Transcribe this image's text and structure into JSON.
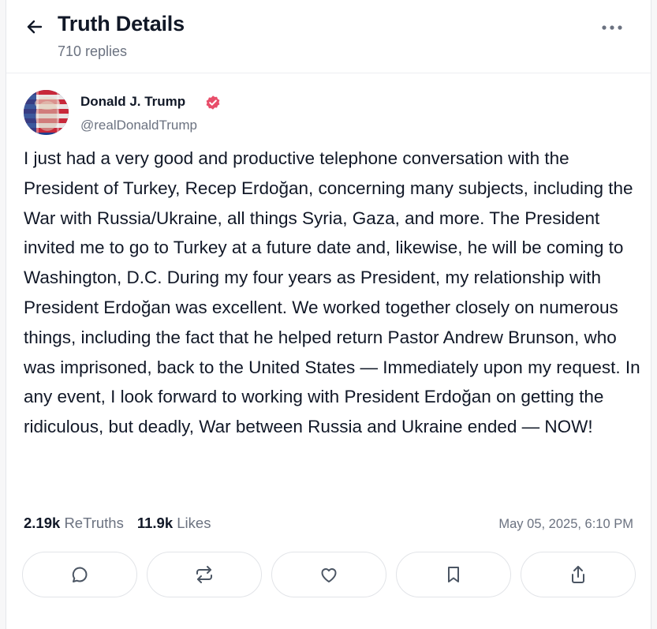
{
  "header": {
    "title": "Truth Details",
    "reply_count": "710 replies",
    "back_icon": "arrow-left-icon",
    "more_icon": "more-horizontal-icon"
  },
  "post": {
    "author": {
      "name": "Donald J. Trump",
      "handle": "@realDonaldTrump",
      "verified": true,
      "verified_color": "#e84e6a"
    },
    "body": "I just had a very good and productive telephone conversation with the President of Turkey, Recep Erdoğan, concerning many subjects, including the War with Russia/Ukraine, all things Syria, Gaza, and more. The President invited me to go to Turkey at a future date and, likewise, he will be coming to Washington, D.C. During my four years as President, my relationship with President Erdoğan was excellent. We worked together closely on numerous things, including the fact that he helped return Pastor Andrew Brunson, who was imprisoned, back to the United States — Immediately upon my request. In any event, I look forward to working with President Erdoğan on getting the ridiculous, but deadly, War between Russia and Ukraine ended — NOW!",
    "stats": {
      "retruths_count": "2.19k",
      "retruths_label": "ReTruths",
      "likes_count": "11.9k",
      "likes_label": "Likes"
    },
    "timestamp": "May 05, 2025, 6:10 PM"
  },
  "actions": [
    {
      "icon": "reply-icon"
    },
    {
      "icon": "retruth-icon"
    },
    {
      "icon": "like-icon"
    },
    {
      "icon": "bookmark-icon"
    },
    {
      "icon": "share-icon"
    }
  ],
  "colors": {
    "text": "#111827",
    "muted": "#6b7280",
    "border": "#e2e4e8",
    "verified": "#e84e6a"
  }
}
